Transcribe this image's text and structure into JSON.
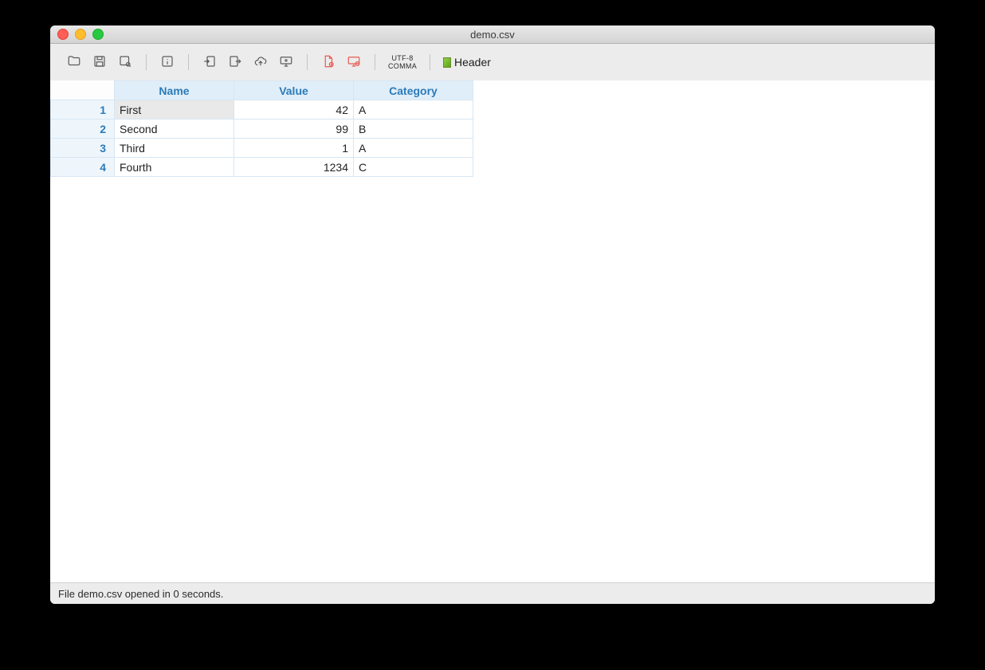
{
  "window": {
    "title": "demo.csv"
  },
  "toolbar": {
    "encoding_line1": "UTF-8",
    "encoding_line2": "COMMA",
    "header_label": "Header"
  },
  "table": {
    "columns": [
      "Name",
      "Value",
      "Category"
    ],
    "column_align": [
      "left",
      "right",
      "left"
    ],
    "rows": [
      {
        "idx": "1",
        "cells": [
          "First",
          "42",
          "A"
        ]
      },
      {
        "idx": "2",
        "cells": [
          "Second",
          "99",
          "B"
        ]
      },
      {
        "idx": "3",
        "cells": [
          "Third",
          "1",
          "A"
        ]
      },
      {
        "idx": "4",
        "cells": [
          "Fourth",
          "1234",
          "C"
        ]
      }
    ],
    "selected_row": 0,
    "selected_col": 0
  },
  "status": {
    "text": "File demo.csv opened in 0 seconds."
  }
}
